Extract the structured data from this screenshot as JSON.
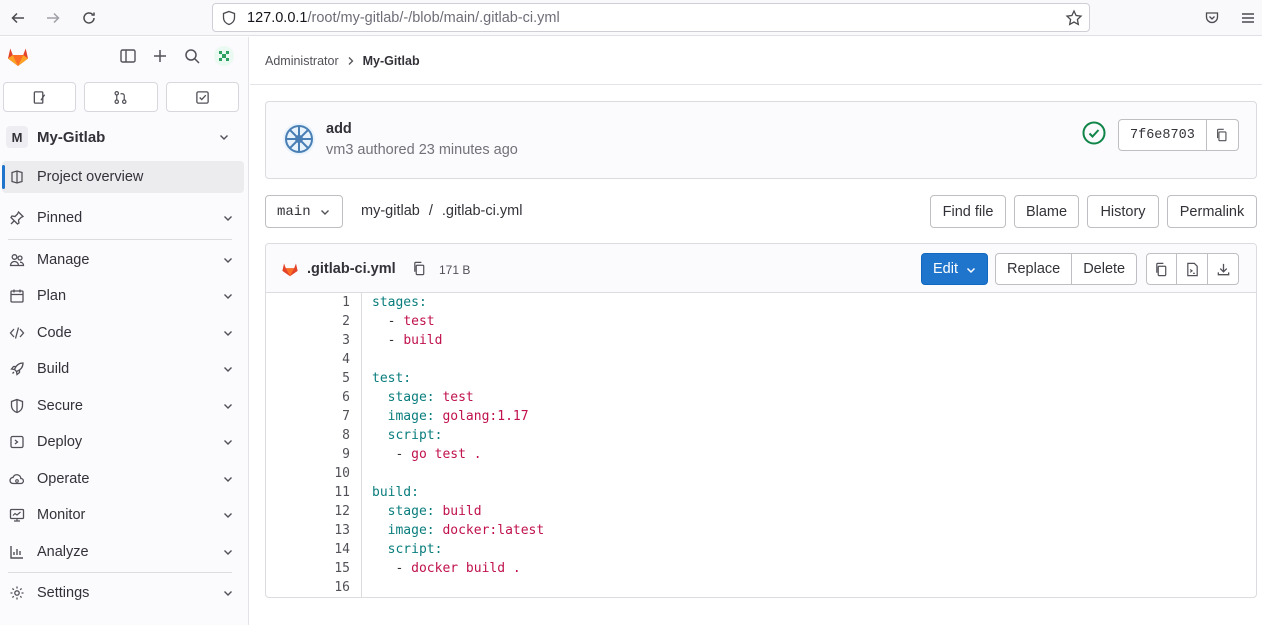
{
  "browser": {
    "url_host": "127.0.0.1",
    "url_path": "/root/my-gitlab/-/blob/main/.gitlab-ci.yml"
  },
  "sidebar": {
    "project_initial": "M",
    "project_name": "My-Gitlab",
    "items": [
      {
        "label": "Project overview",
        "icon": "project-icon"
      },
      {
        "label": "Pinned",
        "icon": "pin-icon"
      },
      {
        "label": "Manage",
        "icon": "users-icon"
      },
      {
        "label": "Plan",
        "icon": "calendar-icon"
      },
      {
        "label": "Code",
        "icon": "code-icon"
      },
      {
        "label": "Build",
        "icon": "rocket-icon"
      },
      {
        "label": "Secure",
        "icon": "shield-icon"
      },
      {
        "label": "Deploy",
        "icon": "deploy-icon"
      },
      {
        "label": "Operate",
        "icon": "cloud-gear-icon"
      },
      {
        "label": "Monitor",
        "icon": "monitor-icon"
      },
      {
        "label": "Analyze",
        "icon": "chart-icon"
      },
      {
        "label": "Settings",
        "icon": "gear-icon"
      }
    ]
  },
  "breadcrumb": {
    "parent": "Administrator",
    "current": "My-Gitlab"
  },
  "commit": {
    "title": "add",
    "subtitle": "vm3 authored 23 minutes ago",
    "sha": "7f6e8703",
    "status_color": "#108548"
  },
  "toolbar": {
    "branch": "main",
    "path_root": "my-gitlab",
    "path_sep": "/",
    "path_file": ".gitlab-ci.yml",
    "find_file": "Find file",
    "blame": "Blame",
    "history": "History",
    "permalink": "Permalink"
  },
  "file": {
    "name": ".gitlab-ci.yml",
    "size": "171 B",
    "edit": "Edit",
    "replace": "Replace",
    "delete": "Delete",
    "accent": "#1f75cb"
  },
  "code": [
    {
      "n": "1",
      "key": "stages:",
      "val": ""
    },
    {
      "n": "2",
      "key": "  - ",
      "val": "test"
    },
    {
      "n": "3",
      "key": "  - ",
      "val": "build"
    },
    {
      "n": "4",
      "key": "",
      "val": ""
    },
    {
      "n": "5",
      "key": "test:",
      "val": ""
    },
    {
      "n": "6",
      "key": "  stage: ",
      "val": "test"
    },
    {
      "n": "7",
      "key": "  image: ",
      "val": "golang:1.17"
    },
    {
      "n": "8",
      "key": "  script:",
      "val": ""
    },
    {
      "n": "9",
      "key": "   - ",
      "val": "go test ."
    },
    {
      "n": "10",
      "key": "",
      "val": ""
    },
    {
      "n": "11",
      "key": "build:",
      "val": ""
    },
    {
      "n": "12",
      "key": "  stage: ",
      "val": "build"
    },
    {
      "n": "13",
      "key": "  image: ",
      "val": "docker:latest"
    },
    {
      "n": "14",
      "key": "  script:",
      "val": ""
    },
    {
      "n": "15",
      "key": "   - ",
      "val": "docker build ."
    },
    {
      "n": "16",
      "key": "",
      "val": ""
    }
  ]
}
